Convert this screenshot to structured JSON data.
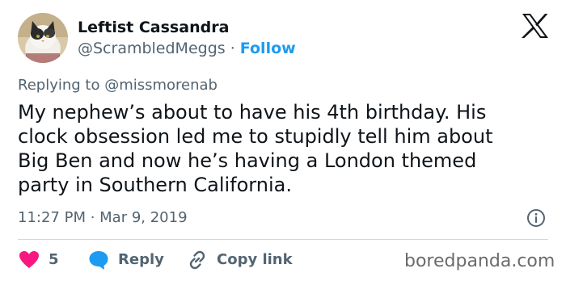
{
  "tweet": {
    "display_name": "Leftist Cassandra",
    "handle": "@ScrambledMeggs",
    "separator": " · ",
    "follow_label": "Follow",
    "reply_to": "Replying to @missmorenab",
    "text": "My nephew’s about to have his 4th birthday. His\nclock obsession led me to stupidly tell him about\nBig Ben and now he’s having a London themed\nparty in Southern California.",
    "timestamp": "11:27 PM · Mar 9, 2019"
  },
  "actions": {
    "like_count": "5",
    "reply_label": "Reply",
    "copy_link_label": "Copy link"
  },
  "watermark": "boredpanda.com",
  "icons": {
    "brand": "x-logo-icon",
    "info": "info-icon",
    "like": "heart-icon",
    "reply": "speech-bubble-icon",
    "copy": "link-icon"
  },
  "colors": {
    "follow": "#1d9bf0",
    "like": "#f91880",
    "reply": "#1d9bf0",
    "secondary_text": "#536471",
    "primary_text": "#0f1419"
  }
}
